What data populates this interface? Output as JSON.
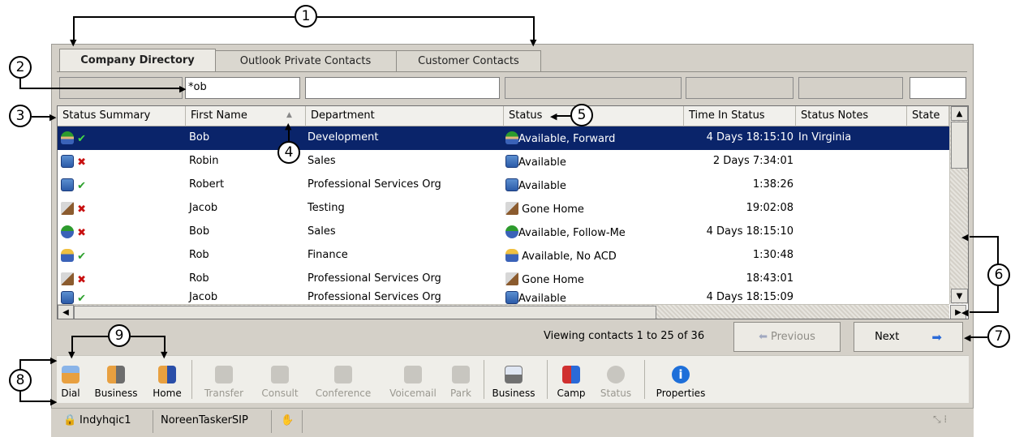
{
  "tabs": [
    "Company Directory",
    "Outlook Private Contacts",
    "Customer Contacts"
  ],
  "filters": {
    "first_name": "*ob"
  },
  "columns": [
    "Status Summary",
    "First Name",
    "Department",
    "Status",
    "Time In Status",
    "Status Notes",
    "State"
  ],
  "rows": [
    {
      "first": "Bob",
      "dept": "Development",
      "status": "Available, Forward",
      "time": "4 Days 18:15:10",
      "notes": "In Virginia"
    },
    {
      "first": "Robin",
      "dept": "Sales",
      "status": "Available",
      "time": "2 Days 7:34:01",
      "notes": ""
    },
    {
      "first": "Robert",
      "dept": "Professional Services Org",
      "status": "Available",
      "time": "1:38:26",
      "notes": ""
    },
    {
      "first": "Jacob",
      "dept": "Testing",
      "status": "Gone Home",
      "time": "19:02:08",
      "notes": ""
    },
    {
      "first": "Bob",
      "dept": "Sales",
      "status": "Available, Follow-Me",
      "time": "4 Days 18:15:10",
      "notes": ""
    },
    {
      "first": "Rob",
      "dept": "Finance",
      "status": "Available, No ACD",
      "time": "1:30:48",
      "notes": ""
    },
    {
      "first": "Rob",
      "dept": "Professional Services Org",
      "status": "Gone Home",
      "time": "18:43:01",
      "notes": ""
    },
    {
      "first": "Jacob",
      "dept": "Professional Services Org",
      "status": "Available",
      "time": "4 Days 18:15:09",
      "notes": ""
    }
  ],
  "pager": {
    "text": "Viewing contacts 1 to 25 of 36",
    "previous": "Previous",
    "next": "Next"
  },
  "toolbar": {
    "dial": "Dial",
    "business1": "Business",
    "home": "Home",
    "transfer": "Transfer",
    "consult": "Consult",
    "conference": "Conference",
    "voicemail": "Voicemail",
    "park": "Park",
    "business2": "Business",
    "camp": "Camp",
    "status": "Status",
    "properties": "Properties"
  },
  "statusbar": {
    "station": "Indyhqic1",
    "user": "NoreenTaskerSIP"
  },
  "callouts": [
    "1",
    "2",
    "3",
    "4",
    "5",
    "6",
    "7",
    "8",
    "9"
  ],
  "colors": {
    "selection": "#0a246a",
    "available": "#2ca02c",
    "unavailable": "#c81010"
  }
}
